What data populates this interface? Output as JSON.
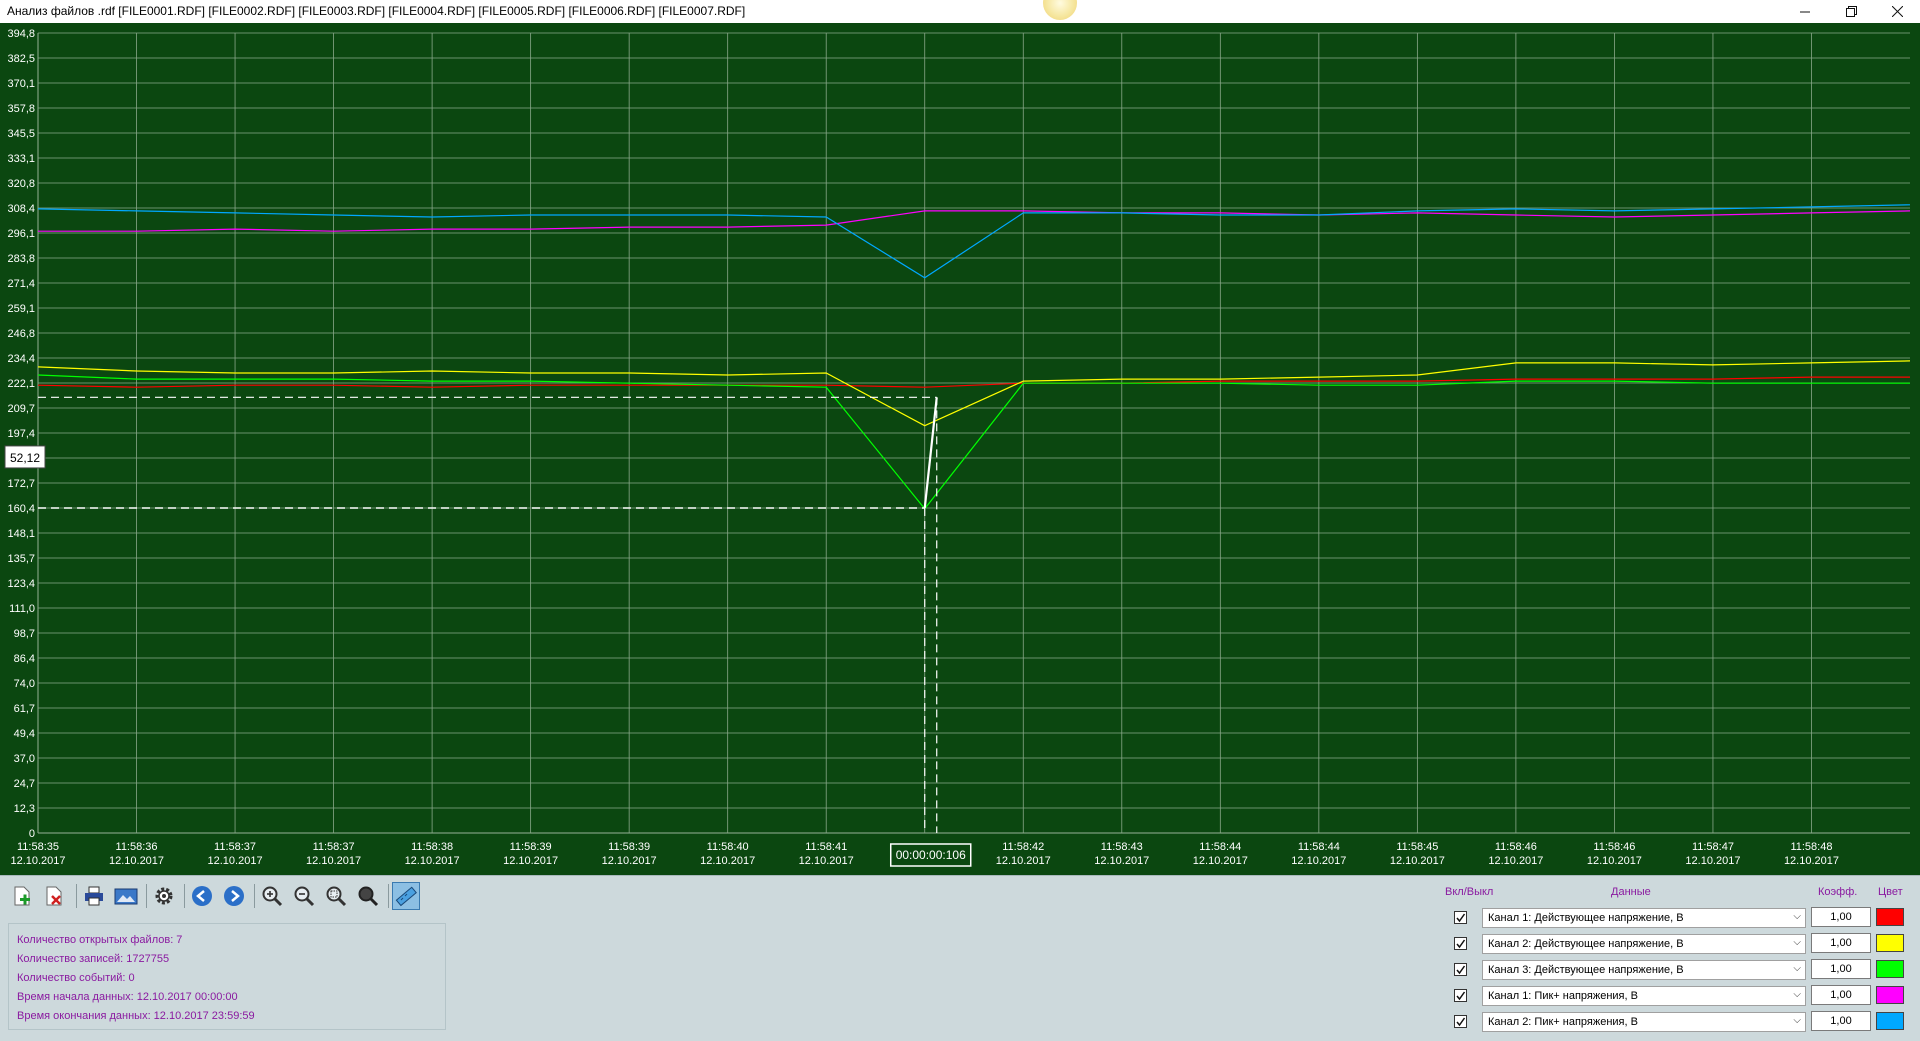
{
  "window": {
    "title": "Анализ файлов .rdf [FILE0001.RDF] [FILE0002.RDF] [FILE0003.RDF] [FILE0004.RDF] [FILE0005.RDF] [FILE0006.RDF] [FILE0007.RDF]",
    "minimize_icon": "minimize-icon",
    "maximize_icon": "restore-icon",
    "close_icon": "close-icon"
  },
  "chart": {
    "background_color": "#0b4710",
    "grid_color": "#8aa88a",
    "y_ticks": [
      "394,8",
      "382,5",
      "370,1",
      "357,8",
      "345,5",
      "333,1",
      "320,8",
      "308,4",
      "296,1",
      "283,8",
      "271,4",
      "259,1",
      "246,8",
      "234,4",
      "222,1",
      "209,7",
      "197,4",
      "185,1",
      "172,7",
      "160,4",
      "148,1",
      "135,7",
      "123,4",
      "111,0",
      "98,7",
      "86,4",
      "74,0",
      "61,7",
      "49,4",
      "37,0",
      "24,7",
      "12,3",
      "0"
    ],
    "x_ticks": [
      {
        "time": "11:58:35",
        "date": "12.10.2017"
      },
      {
        "time": "11:58:36",
        "date": "12.10.2017"
      },
      {
        "time": "11:58:37",
        "date": "12.10.2017"
      },
      {
        "time": "11:58:37",
        "date": "12.10.2017"
      },
      {
        "time": "11:58:38",
        "date": "12.10.2017"
      },
      {
        "time": "11:58:39",
        "date": "12.10.2017"
      },
      {
        "time": "11:58:39",
        "date": "12.10.2017"
      },
      {
        "time": "11:58:40",
        "date": "12.10.2017"
      },
      {
        "time": "11:58:41",
        "date": "12.10.2017"
      },
      {
        "time": "",
        "date": ""
      },
      {
        "time": "11:58:42",
        "date": "12.10.2017"
      },
      {
        "time": "11:58:43",
        "date": "12.10.2017"
      },
      {
        "time": "11:58:44",
        "date": "12.10.2017"
      },
      {
        "time": "11:58:44",
        "date": "12.10.2017"
      },
      {
        "time": "11:58:45",
        "date": "12.10.2017"
      },
      {
        "time": "11:58:46",
        "date": "12.10.2017"
      },
      {
        "time": "11:58:46",
        "date": "12.10.2017"
      },
      {
        "time": "11:58:47",
        "date": "12.10.2017"
      },
      {
        "time": "11:58:48",
        "date": "12.10.2017"
      }
    ],
    "marker_value_label": "52,12",
    "marker_time_label": "00:00:00:106"
  },
  "chart_data": {
    "type": "line",
    "ylim": [
      0,
      394.8
    ],
    "grid": true,
    "x": [
      "11:58:35",
      "11:58:36",
      "11:58:37",
      "11:58:37",
      "11:58:38",
      "11:58:39",
      "11:58:39",
      "11:58:40",
      "11:58:41",
      "11:58:41.5",
      "11:58:42",
      "11:58:43",
      "11:58:44",
      "11:58:44",
      "11:58:45",
      "11:58:46",
      "11:58:46",
      "11:58:47",
      "11:58:48",
      "11:58:48.8"
    ],
    "series": [
      {
        "name": "Канал 1: Действующее напряжение, В",
        "color": "#ff0000",
        "values": [
          221,
          220,
          221,
          221,
          220,
          221,
          221,
          221,
          221,
          220,
          222,
          222,
          223,
          223,
          223,
          224,
          224,
          224,
          225,
          225
        ]
      },
      {
        "name": "Канал 2: Действующее напряжение, В",
        "color": "#ffff00",
        "values": [
          230,
          228,
          227,
          227,
          228,
          227,
          227,
          226,
          227,
          201,
          223,
          224,
          224,
          225,
          226,
          232,
          232,
          231,
          232,
          233
        ]
      },
      {
        "name": "Канал 3: Действующее напряжение, В",
        "color": "#00ff00",
        "values": [
          226,
          224,
          224,
          224,
          223,
          223,
          222,
          221,
          220,
          160,
          222,
          222,
          222,
          221,
          221,
          223,
          223,
          222,
          222,
          222
        ]
      },
      {
        "name": "Канал 1: Пик+ напряжения, В",
        "color": "#ff00ff",
        "values": [
          297,
          297,
          298,
          297,
          298,
          298,
          299,
          299,
          300,
          307,
          307,
          306,
          306,
          305,
          306,
          305,
          304,
          305,
          306,
          307
        ]
      },
      {
        "name": "Канал 2: Пик+ напряжения, В",
        "color": "#00a8ff",
        "values": [
          308,
          307,
          306,
          305,
          304,
          305,
          305,
          305,
          304,
          274,
          306,
          306,
          305,
          305,
          307,
          308,
          307,
          308,
          309,
          310
        ]
      }
    ],
    "cursor": {
      "high_value": 215,
      "low_value": 160.4,
      "delta_value": "52,12",
      "delta_time": "00:00:00:106"
    }
  },
  "toolbar": {
    "icons": [
      "add-file-icon",
      "remove-file-icon",
      "print-icon",
      "export-image-icon",
      "settings-gear-icon",
      "back-arrow-icon",
      "forward-arrow-icon",
      "zoom-in-icon",
      "zoom-out-icon",
      "zoom-region-icon",
      "zoom-fit-icon",
      "measure-ruler-icon"
    ]
  },
  "info": {
    "open_files": "Количество открытых файлов: 7",
    "records": "Количество записей: 1727755",
    "events": "Количество событий: 0",
    "data_start": "Время начала данных: 12.10.2017 00:00:00",
    "data_end": "Время окончания данных: 12.10.2017 23:59:59"
  },
  "channels_panel": {
    "header_toggle": "Вкл/Выкл",
    "header_data": "Данные",
    "header_coef": "Коэфф.",
    "header_color": "Цвет",
    "rows": [
      {
        "checked": true,
        "label": "Канал 1: Действующее напряжение, В",
        "coef": "1,00",
        "color": "#ff0000"
      },
      {
        "checked": true,
        "label": "Канал 2: Действующее напряжение, В",
        "coef": "1,00",
        "color": "#ffff00"
      },
      {
        "checked": true,
        "label": "Канал 3: Действующее напряжение, В",
        "coef": "1,00",
        "color": "#00ff00"
      },
      {
        "checked": true,
        "label": "Канал 1: Пик+ напряжения, В",
        "coef": "1,00",
        "color": "#ff00ff"
      },
      {
        "checked": true,
        "label": "Канал 2: Пик+ напряжения, В",
        "coef": "1,00",
        "color": "#00a8ff"
      }
    ]
  }
}
